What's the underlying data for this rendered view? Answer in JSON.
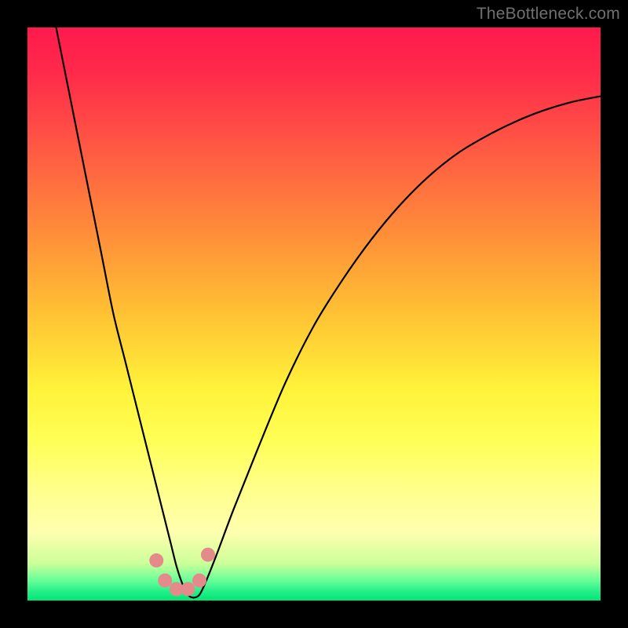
{
  "watermark": "TheBottleneck.com",
  "gradient_stops": [
    {
      "offset": 0.0,
      "color": "#ff1a4d"
    },
    {
      "offset": 0.08,
      "color": "#ff2a4a"
    },
    {
      "offset": 0.2,
      "color": "#ff5544"
    },
    {
      "offset": 0.35,
      "color": "#ff8a3a"
    },
    {
      "offset": 0.5,
      "color": "#ffc233"
    },
    {
      "offset": 0.63,
      "color": "#fff23a"
    },
    {
      "offset": 0.72,
      "color": "#ffff55"
    },
    {
      "offset": 0.8,
      "color": "#ffff88"
    },
    {
      "offset": 0.88,
      "color": "#ffffaf"
    },
    {
      "offset": 0.935,
      "color": "#ccff99"
    },
    {
      "offset": 0.965,
      "color": "#66ff99"
    },
    {
      "offset": 0.985,
      "color": "#22ee88"
    },
    {
      "offset": 1.0,
      "color": "#00e676"
    }
  ],
  "chart_data": {
    "type": "line",
    "title": "",
    "xlabel": "",
    "ylabel": "",
    "xlim": [
      0,
      100
    ],
    "ylim": [
      0,
      100
    ],
    "series": [
      {
        "name": "bottleneck-curve",
        "x": [
          5,
          7,
          9,
          11,
          13,
          15,
          17,
          19,
          21,
          22,
          23,
          24,
          25,
          26,
          27,
          28,
          29,
          30,
          31,
          33,
          36,
          40,
          45,
          50,
          55,
          60,
          65,
          70,
          75,
          80,
          85,
          90,
          95,
          100
        ],
        "values": [
          100,
          90,
          80,
          70,
          60,
          50,
          42,
          34,
          26,
          22,
          18,
          14,
          10,
          6,
          3,
          1,
          0.5,
          1,
          3,
          8,
          16,
          26,
          38,
          48,
          56,
          63,
          69,
          74,
          78,
          81,
          83.5,
          85.5,
          87,
          88
        ]
      }
    ],
    "markers": {
      "name": "bottom-dots",
      "color": "#e58a8a",
      "points": [
        {
          "x": 22.5,
          "y": 7.0
        },
        {
          "x": 24.0,
          "y": 3.5
        },
        {
          "x": 26.0,
          "y": 2.0
        },
        {
          "x": 28.0,
          "y": 2.0
        },
        {
          "x": 30.0,
          "y": 3.5
        },
        {
          "x": 31.5,
          "y": 8.0
        }
      ]
    }
  }
}
